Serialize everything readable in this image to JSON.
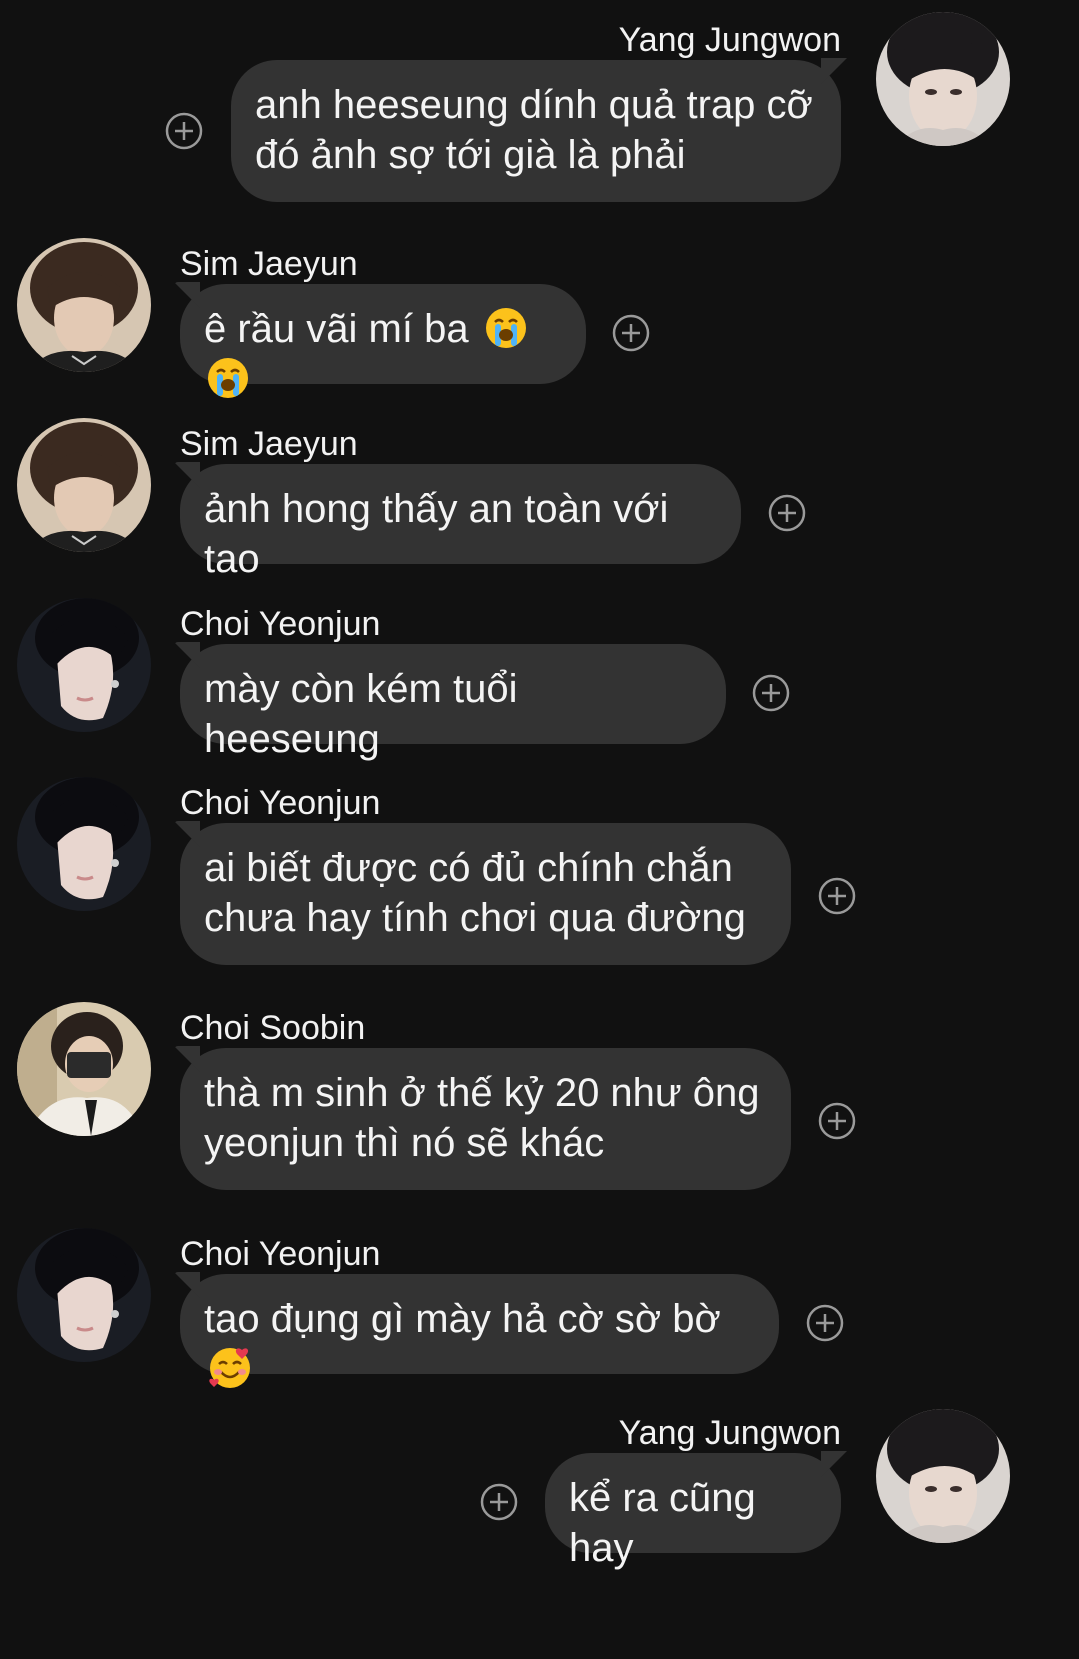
{
  "messages": [
    {
      "sender": "Yang Jungwon",
      "text": "anh heeseung dính quả trap cỡ đó ảnh sợ tới già là phải",
      "emoji": []
    },
    {
      "sender": "Sim Jaeyun",
      "text": "ê rầu vãi mí ba",
      "emoji": [
        "loudly-crying-face-emoji",
        "loudly-crying-face-emoji"
      ]
    },
    {
      "sender": "Sim Jaeyun",
      "text": "ảnh hong thấy an toàn với tao",
      "emoji": []
    },
    {
      "sender": "Choi Yeonjun",
      "text": "mày còn kém tuổi heeseung",
      "emoji": []
    },
    {
      "sender": "Choi Yeonjun",
      "text": "ai biết được có đủ chính chắn chưa hay tính chơi qua đường",
      "emoji": []
    },
    {
      "sender": "Choi Soobin",
      "text": "thà m sinh ở thế kỷ 20 như ông yeonjun thì nó sẽ khác",
      "emoji": []
    },
    {
      "sender": "Choi Yeonjun",
      "text": "tao đụng gì mày hả cờ sờ bờ",
      "emoji": [
        "smiling-face-with-hearts-emoji"
      ]
    },
    {
      "sender": "Yang Jungwon",
      "text": "kể ra cũng hay",
      "emoji": []
    }
  ],
  "icons": {
    "reaction": "add-reaction-icon",
    "avatar": "profile-photo"
  },
  "colors": {
    "background": "#111111",
    "bubble": "#333333",
    "text": "#f4f4f4",
    "reaction_icon": "#9a9a9a"
  }
}
